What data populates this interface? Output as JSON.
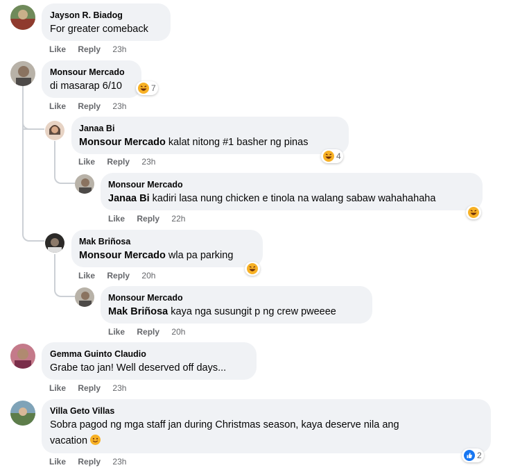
{
  "actions": {
    "like": "Like",
    "reply": "Reply"
  },
  "comments": [
    {
      "name": "Jayson R. Biadog",
      "text": "For greater comeback",
      "time": "23h"
    },
    {
      "name": "Monsour Mercado",
      "text": "di masarap 6/10",
      "time": "23h",
      "reaction": {
        "icon": "laugh-emoji",
        "count": "7"
      }
    },
    {
      "name": "Janaa Bi",
      "tag": "Monsour Mercado",
      "text": " kalat nitong #1 basher ng pinas",
      "time": "23h",
      "reaction": {
        "icon": "laugh-emoji",
        "count": "4"
      }
    },
    {
      "name": "Monsour Mercado",
      "tag": "Janaa Bi",
      "text": " kadiri lasa nung chicken e tinola na walang sabaw wahahahaha",
      "time": "22h",
      "reaction": {
        "icon": "laugh-emoji"
      }
    },
    {
      "name": "Mak Briñosa",
      "tag": "Monsour Mercado",
      "text": " wla pa parking",
      "time": "20h",
      "reaction": {
        "icon": "laugh-emoji"
      }
    },
    {
      "name": "Monsour Mercado",
      "tag": "Mak Briñosa",
      "text": " kaya nga susungit p ng crew pweeee",
      "time": "20h"
    },
    {
      "name": "Gemma Guinto Claudio",
      "text": "Grabe tao jan! Well deserved off days...",
      "time": "23h"
    },
    {
      "name": "Villa Geto Villas",
      "text": "Sobra pagod ng mga staff jan during Christmas season, kaya deserve nila ang",
      "text2": "vacation",
      "time": "23h",
      "reaction": {
        "icon": "like-emoji",
        "count": "2"
      }
    }
  ],
  "colors": {
    "bubble": "#f0f2f5",
    "meta": "#65676b",
    "like_blue": "#1877f2",
    "emoji_yellow": "#f7b125"
  }
}
